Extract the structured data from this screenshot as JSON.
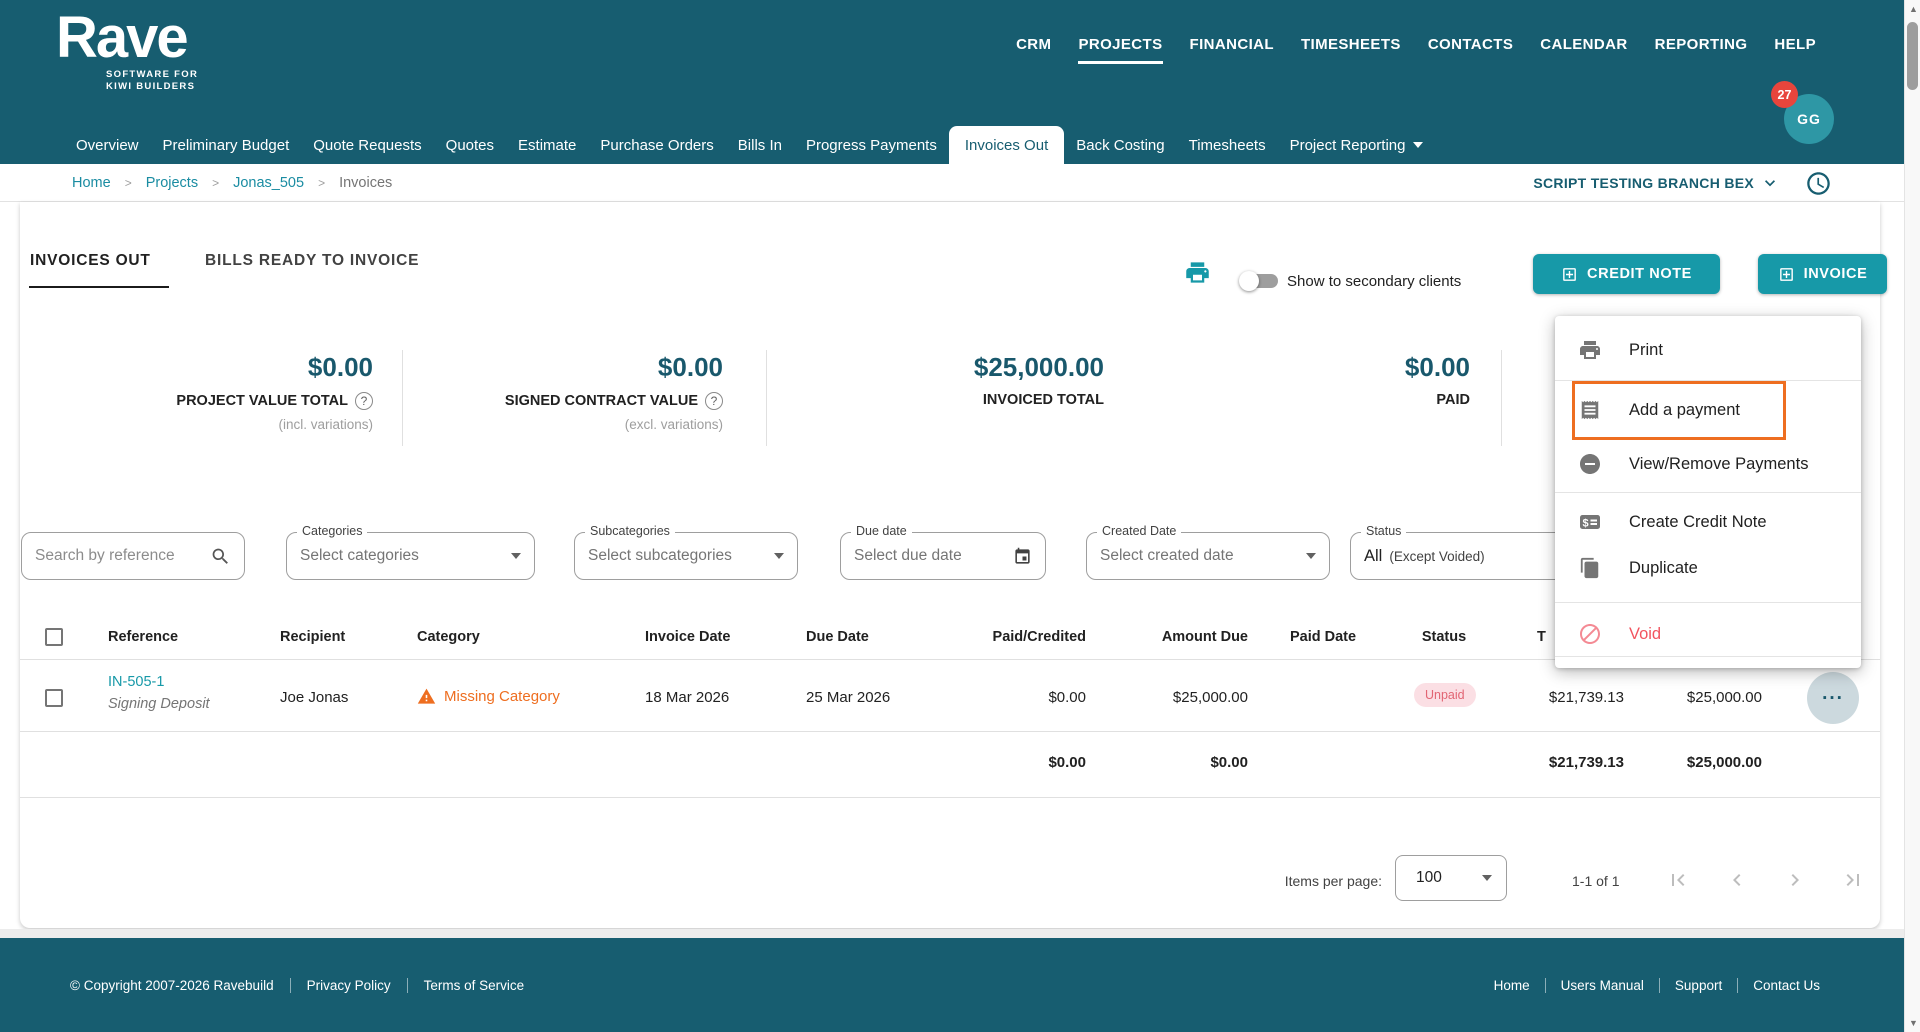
{
  "colors": {
    "header_teal": "#175d70",
    "accent_teal": "#1799a8",
    "highlight_orange": "#ee6e20",
    "danger_red": "#f2545f",
    "unpaid_bg": "#fbdfe4",
    "unpaid_text": "#e26573"
  },
  "header": {
    "logo_title": "Rave",
    "logo_subtitle_1": "SOFTWARE FOR",
    "logo_subtitle_2": "KIWI BUILDERS",
    "nav": [
      {
        "label": "CRM"
      },
      {
        "label": "PROJECTS"
      },
      {
        "label": "FINANCIAL"
      },
      {
        "label": "TIMESHEETS"
      },
      {
        "label": "CONTACTS"
      },
      {
        "label": "CALENDAR"
      },
      {
        "label": "REPORTING"
      },
      {
        "label": "HELP"
      }
    ],
    "avatar": {
      "initials": "GG",
      "badge_count": "27"
    },
    "subnav": [
      {
        "label": "Overview"
      },
      {
        "label": "Preliminary Budget"
      },
      {
        "label": "Quote Requests"
      },
      {
        "label": "Quotes"
      },
      {
        "label": "Estimate"
      },
      {
        "label": "Purchase Orders"
      },
      {
        "label": "Bills In"
      },
      {
        "label": "Progress Payments"
      },
      {
        "label": "Invoices Out"
      },
      {
        "label": "Back Costing"
      },
      {
        "label": "Timesheets"
      },
      {
        "label": "Project Reporting"
      }
    ]
  },
  "breadcrumb": {
    "items": [
      "Home",
      "Projects",
      "Jonas_505",
      "Invoices"
    ],
    "branch_selector": "SCRIPT TESTING BRANCH BEX"
  },
  "toolbar": {
    "tab_invoices_out": "INVOICES OUT",
    "tab_bills_ready": "BILLS READY TO INVOICE",
    "toggle_label": "Show to secondary clients",
    "credit_note_button": "CREDIT NOTE",
    "invoice_button": "INVOICE"
  },
  "stats": [
    {
      "value": "$0.00",
      "label": "PROJECT VALUE TOTAL",
      "sub": "(incl. variations)"
    },
    {
      "value": "$0.00",
      "label": "SIGNED CONTRACT VALUE",
      "sub": "(excl. variations)"
    },
    {
      "value": "$25,000.00",
      "label": "INVOICED TOTAL",
      "sub": ""
    },
    {
      "value": "$0.00",
      "label": "PAID",
      "sub": ""
    }
  ],
  "filters": {
    "search_placeholder": "Search by reference",
    "categories": {
      "label": "Categories",
      "value": "Select categories"
    },
    "subcategories": {
      "label": "Subcategories",
      "value": "Select subcategories"
    },
    "due_date": {
      "label": "Due date",
      "value": "Select due date"
    },
    "created_date": {
      "label": "Created Date",
      "value": "Select created date"
    },
    "status": {
      "label": "Status",
      "value": "All",
      "value_suffix": "(Except Voided)"
    }
  },
  "context_menu": {
    "items": [
      {
        "label": "Print"
      },
      {
        "label": "Add a payment"
      },
      {
        "label": "View/Remove Payments"
      },
      {
        "label": "Create Credit Note"
      },
      {
        "label": "Duplicate"
      },
      {
        "label": "Void"
      }
    ]
  },
  "table": {
    "headers": {
      "reference": "Reference",
      "recipient": "Recipient",
      "category": "Category",
      "invoice_date": "Invoice Date",
      "due_date": "Due Date",
      "paid_credited": "Paid/Credited",
      "amount_due": "Amount Due",
      "paid_date": "Paid Date",
      "status": "Status",
      "total_truncated": "T"
    },
    "row": {
      "reference": "IN-505-1",
      "reference_sub": "Signing Deposit",
      "recipient": "Joe Jonas",
      "category_warning": "Missing Category",
      "invoice_date": "18 Mar 2026",
      "due_date": "25 Mar 2026",
      "paid_credited": "$0.00",
      "amount_due": "$25,000.00",
      "status": "Unpaid",
      "total_1": "$21,739.13",
      "total_2": "$25,000.00"
    },
    "totals": {
      "paid_credited": "$0.00",
      "amount_due": "$0.00",
      "total_1": "$21,739.13",
      "total_2": "$25,000.00"
    }
  },
  "pagination": {
    "items_per_page_label": "Items per page:",
    "items_per_page_value": "100",
    "range": "1-1 of 1"
  },
  "footer": {
    "copyright": "© Copyright 2007-2026 Ravebuild",
    "privacy": "Privacy Policy",
    "terms": "Terms of Service",
    "home": "Home",
    "users_manual": "Users Manual",
    "support": "Support",
    "contact": "Contact Us"
  }
}
